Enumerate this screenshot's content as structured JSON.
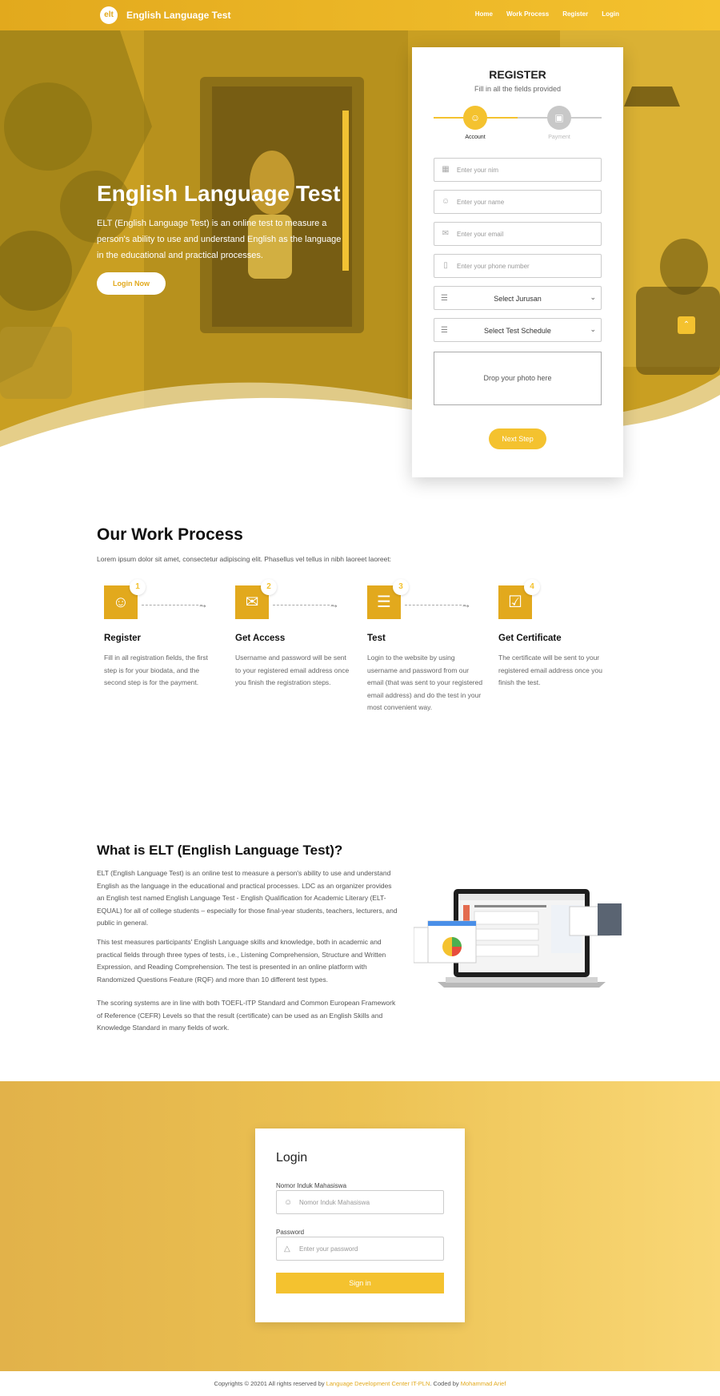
{
  "nav": {
    "logo_text": "elt",
    "brand": "English Language Test",
    "links": [
      "Home",
      "Work Process",
      "Register",
      "Login"
    ]
  },
  "hero": {
    "title": "English Language Test",
    "text": "ELT (English Language Test) is an online test to measure a person's ability to use and understand English as the language in the educational and practical processes.",
    "button": "Login Now",
    "scroll_top_icon": "chevron-up-icon"
  },
  "register": {
    "title": "REGISTER",
    "subtitle": "Fill in all the fields provided",
    "steps": [
      {
        "label": "Account",
        "icon": "user-icon",
        "active": true
      },
      {
        "label": "Payment",
        "icon": "card-icon",
        "active": false
      }
    ],
    "fields": [
      {
        "placeholder": "Enter your nim",
        "icon": "id-card-icon"
      },
      {
        "placeholder": "Enter your name",
        "icon": "user-icon"
      },
      {
        "placeholder": "Enter your email",
        "icon": "envelope-icon"
      },
      {
        "placeholder": "Enter your phone number",
        "icon": "phone-icon"
      }
    ],
    "selects": [
      {
        "value": "Select Jurusan",
        "icon": "list-icon"
      },
      {
        "value": "Select Test Schedule",
        "icon": "list-icon"
      }
    ],
    "drop_text": "Drop your photo here",
    "next_button": "Next Step"
  },
  "work_process": {
    "title": "Our Work Process",
    "subtitle": "Lorem ipsum dolor sit amet, consectetur adipiscing elit. Phasellus vel tellus in nibh laoreet laoreet:",
    "steps": [
      {
        "num": "1",
        "icon": "user-icon",
        "title": "Register",
        "desc": "Fill in all registration fields, the first step is for your biodata, and the second step is for the payment."
      },
      {
        "num": "2",
        "icon": "envelope-icon",
        "title": "Get Access",
        "desc": "Username and password will be sent to your registered email address once you finish the registration steps."
      },
      {
        "num": "3",
        "icon": "list-icon",
        "title": "Test",
        "desc": "Login to the website by using username and password from our email (that was sent to your registered email address) and do the test in your most convenient way."
      },
      {
        "num": "4",
        "icon": "checkbox-icon",
        "title": "Get Certificate",
        "desc": "The certificate will be sent to your registered email address once you finish the test."
      }
    ]
  },
  "elt": {
    "title": "What is ELT (English Language Test)?",
    "p1": "ELT (English Language Test) is an online test to measure a person's ability to use and understand English as the language in the educational and practical processes. LDC as an organizer provides an English test named English Language Test - English Qualification for Academic Literary (ELT-EQUAL) for all of college students – especially for those final-year students, teachers, lecturers, and public in general.",
    "p2": "This test measures participants' English Language skills and knowledge, both in academic and practical fields through three types of tests, i.e., Listening Comprehension, Structure and Written Expression, and Reading Comprehension. The test is presented in an online platform with Randomized Questions Feature (RQF) and more than 10 different test types.",
    "p3": "The scoring systems are in line with both TOEFL-ITP Standard and Common European Framework of Reference (CEFR) Levels so that the result (certificate) can be used as an English Skills and Knowledge Standard in many fields of work."
  },
  "login": {
    "title": "Login",
    "nim_label": "Nomor Induk Mahasiswa",
    "nim_placeholder": "Nomor Induk Mahasiswa",
    "password_label": "Password",
    "password_placeholder": "Enter your password",
    "button": "Sign in"
  },
  "footer": {
    "prefix": "Copyrights © 20201 All rights reserved by ",
    "org": "Language Development Center IT-PLN",
    "mid": ". Coded by ",
    "author": "Mohammad Arief"
  },
  "colors": {
    "accent": "#f4c22f",
    "accent_dark": "#e2a91d"
  }
}
